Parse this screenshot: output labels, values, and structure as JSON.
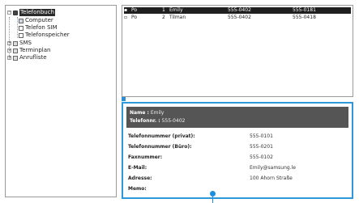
{
  "tree": {
    "root": {
      "label": "Telefonbuch",
      "expander": "−"
    },
    "children": [
      {
        "label": "Computer",
        "icon": "pc-icon"
      },
      {
        "label": "Telefon SIM",
        "icon": "sim-icon"
      },
      {
        "label": "Telefonspeicher",
        "icon": "memory-icon"
      }
    ],
    "groups": [
      {
        "label": "SMS",
        "expander": "+"
      },
      {
        "label": "Terminplan",
        "expander": "+"
      },
      {
        "label": "Anrufliste",
        "expander": "+"
      }
    ]
  },
  "list": {
    "rows": [
      {
        "name": "Po",
        "num": "1",
        "first": "Emily",
        "tel": "555-0402",
        "tel2": "555-0181",
        "selected": true
      },
      {
        "name": "Po",
        "num": "2",
        "first": "Tilman",
        "tel": "555-0402",
        "tel2": "555-0418",
        "selected": false
      }
    ]
  },
  "detail": {
    "name_label": "Name :",
    "name_value": "Emily",
    "phone_label": "Telefonnr. :",
    "phone_value": "555-0402",
    "fields": [
      {
        "label": "Telefonnummer (privat):",
        "value": "555-0101"
      },
      {
        "label": "Telefonnummer (Büro):",
        "value": "555-0201"
      },
      {
        "label": "Faxnummer:",
        "value": "555-0102"
      },
      {
        "label": "E-Mail:",
        "value": "Emily@samsung.le"
      },
      {
        "label": "Adresse:",
        "value": "100 Ahorn Straße"
      },
      {
        "label": "Memo:",
        "value": ""
      }
    ]
  },
  "colors": {
    "accent": "#2e98d8",
    "header_bg": "#555555",
    "selection": "#1f1f1f"
  }
}
